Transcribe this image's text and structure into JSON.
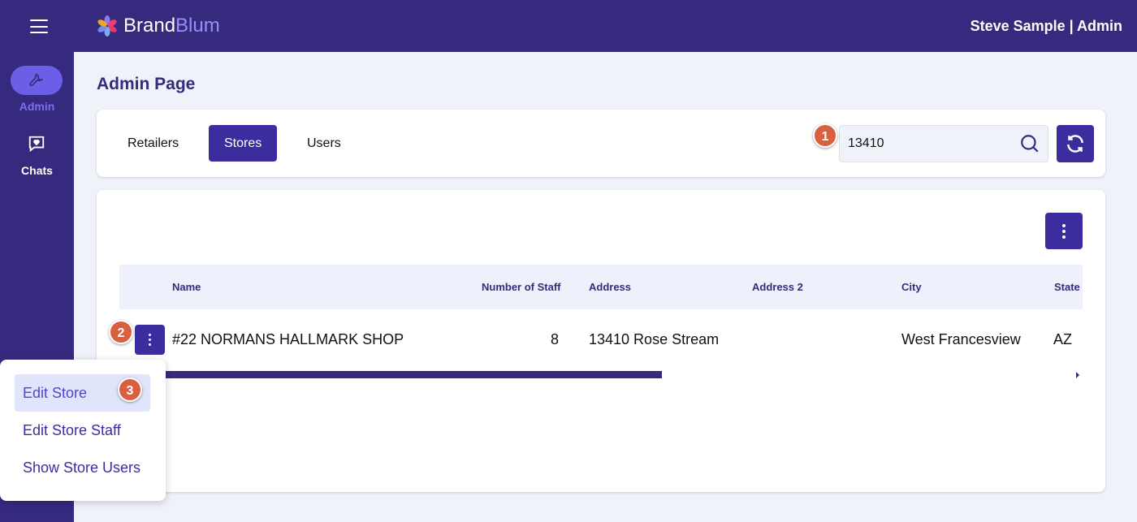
{
  "header": {
    "brand_part1": "Brand",
    "brand_part2": "Blum",
    "user": "Steve Sample | Admin"
  },
  "sidebar": {
    "items": [
      {
        "label": "Admin",
        "icon": "wrench-icon",
        "active": true
      },
      {
        "label": "Chats",
        "icon": "chat-heart-icon"
      }
    ]
  },
  "page": {
    "title": "Admin Page"
  },
  "tabs": [
    {
      "label": "Retailers"
    },
    {
      "label": "Stores",
      "active": true
    },
    {
      "label": "Users"
    }
  ],
  "search": {
    "value": "13410",
    "icon": "search-icon"
  },
  "badges": [
    "1",
    "2",
    "3"
  ],
  "table": {
    "columns": [
      "Name",
      "Number of Staff",
      "Address",
      "Address 2",
      "City",
      "State"
    ],
    "rows": [
      {
        "name": "#22 NORMANS HALLMARK SHOP",
        "staff": "8",
        "address": "13410 Rose Stream",
        "address2": "",
        "city": "West Francesview",
        "state": "AZ"
      }
    ]
  },
  "row_menu": {
    "items": [
      "Edit Store",
      "Edit Store Staff",
      "Show Store Users"
    ]
  },
  "colors": {
    "primary": "#3c2d9e",
    "header": "#352a7e",
    "badge": "#d9603f"
  }
}
